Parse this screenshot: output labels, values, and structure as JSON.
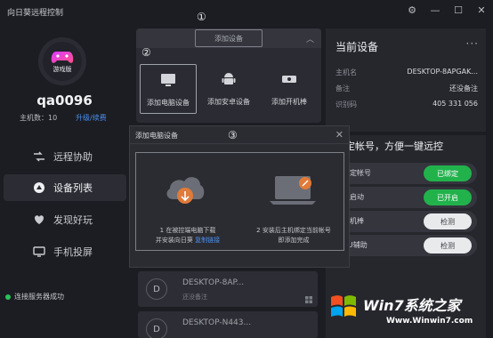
{
  "window": {
    "title": "向日葵远程控制"
  },
  "sidebar": {
    "avatar_badge": "游戏版",
    "username": "qa0096",
    "host_count_label": "主机数：",
    "host_count_value": "10",
    "upgrade_link": "升级/续费",
    "items": [
      {
        "label": "远程协助",
        "icon": "remote-assist-icon"
      },
      {
        "label": "设备列表",
        "icon": "device-list-icon",
        "active": true
      },
      {
        "label": "发现好玩",
        "icon": "discover-icon"
      },
      {
        "label": "手机投屏",
        "icon": "phone-cast-icon"
      }
    ],
    "status": "连接服务器成功"
  },
  "add_panel": {
    "header_button": "添加设备",
    "options": [
      {
        "label": "添加电脑设备",
        "icon": "monitor-icon",
        "active": true
      },
      {
        "label": "添加安卓设备",
        "icon": "android-icon"
      },
      {
        "label": "添加开机棒",
        "icon": "power-stick-icon"
      }
    ]
  },
  "markers": [
    "①",
    "②",
    "③"
  ],
  "current_device": {
    "title": "当前设备",
    "rows": [
      {
        "key": "主机名",
        "value": "DESKTOP-8APGAK..."
      },
      {
        "key": "备注",
        "value": "还没备注"
      },
      {
        "key": "识别码",
        "value": "405 331 056"
      }
    ]
  },
  "binding": {
    "title": "机绑定帐号，方便一键远控",
    "rows": [
      {
        "label": "主机绑定帐号",
        "action": "已绑定",
        "style": "green"
      },
      {
        "label": "开机自启动",
        "action": "已开启",
        "style": "green"
      },
      {
        "label": "搭配开机棒",
        "action": "检测",
        "style": "gray"
      },
      {
        "label": "搭配UU辅助",
        "action": "检测",
        "style": "gray"
      }
    ]
  },
  "device_list": [
    {
      "initial": "D",
      "name": "DESKTOP-8AP...",
      "note": "还没备注"
    },
    {
      "initial": "D",
      "name": "DESKTOP-N443..."
    }
  ],
  "dialog": {
    "title": "添加电脑设备",
    "step1_line1": "1 在被控端电脑下载",
    "step1_line2": "并安装向日葵",
    "step1_link": "复制链接",
    "step2_line1": "2 安装后主机绑定当前帐号",
    "step2_line2": "即添加完成"
  },
  "watermark": {
    "brand": "Win7系统之家",
    "url": "Www.Winwin7.com"
  },
  "colors": {
    "accent_green": "#22b24c",
    "link_blue": "#4a8ef0",
    "background": "#1c1d22"
  }
}
